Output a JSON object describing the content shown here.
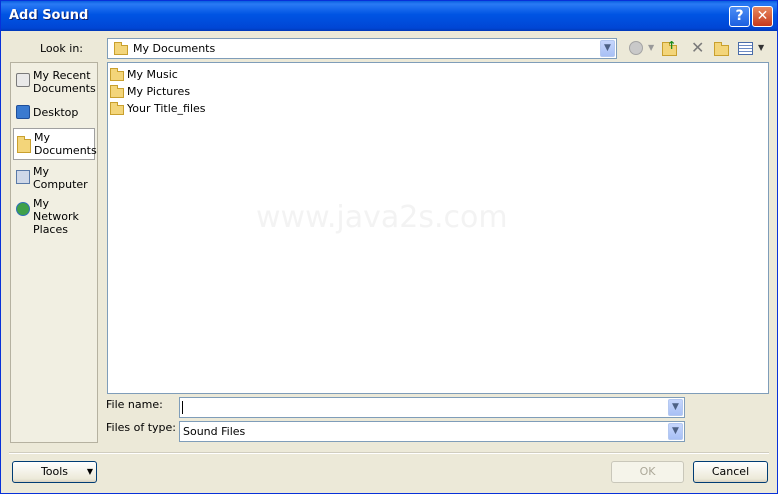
{
  "window": {
    "title": "Add Sound",
    "help_glyph": "?",
    "close_glyph": "✕"
  },
  "look_in": {
    "label": "Look in:",
    "value": "My Documents"
  },
  "places": [
    {
      "label": "My Recent Documents",
      "icon": "recent-documents-icon"
    },
    {
      "label": "Desktop",
      "icon": "desktop-icon"
    },
    {
      "label": "My Documents",
      "icon": "my-documents-icon"
    },
    {
      "label": "My Computer",
      "icon": "my-computer-icon"
    },
    {
      "label": "My Network Places",
      "icon": "network-places-icon"
    }
  ],
  "files": [
    {
      "name": "My Music",
      "icon": "folder-icon"
    },
    {
      "name": "My Pictures",
      "icon": "folder-icon"
    },
    {
      "name": "Your Title_files",
      "icon": "folder-icon"
    }
  ],
  "watermark": "www.java2s.com",
  "file_name": {
    "label": "File name:",
    "value": ""
  },
  "file_type": {
    "label": "Files of type:",
    "value": "Sound Files"
  },
  "buttons": {
    "tools": "Tools",
    "ok": "OK",
    "cancel": "Cancel"
  },
  "colors": {
    "titlebar": "#0054e3",
    "dialog_bg": "#ece9d8",
    "field_border": "#7f9db9"
  }
}
